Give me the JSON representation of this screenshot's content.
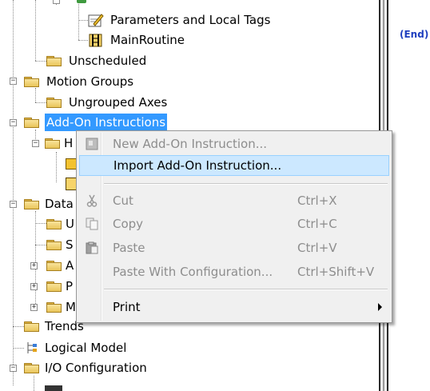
{
  "tree": {
    "parameters_label": "Parameters and Local Tags",
    "mainroutine_label": "MainRoutine",
    "unscheduled_label": "Unscheduled",
    "motion_groups_label": "Motion Groups",
    "ungrouped_axes_label": "Ungrouped Axes",
    "addon_label": "Add-On Instructions",
    "addon_child_partial": "H",
    "data_partial": "Data",
    "data_child1_partial": "U",
    "data_child2_partial": "S",
    "data_child3_partial": "A",
    "data_child4_partial": "P",
    "data_child5_partial": "M",
    "trends_label": "Trends",
    "logical_model_label": "Logical Model",
    "io_config_label": "I/O Configuration",
    "expander_collapse": "−",
    "expander_expand": "+"
  },
  "rung": {
    "end_label": "(End)"
  },
  "context_menu": {
    "new_aoi": "New Add-On Instruction...",
    "import_aoi": "Import Add-On Instruction...",
    "cut": "Cut",
    "cut_key": "Ctrl+X",
    "copy": "Copy",
    "copy_key": "Ctrl+C",
    "paste": "Paste",
    "paste_key": "Ctrl+V",
    "paste_config": "Paste With Configuration...",
    "paste_config_key": "Ctrl+Shift+V",
    "print": "Print"
  },
  "colors": {
    "selection": "#3399ff",
    "menu_highlight": "#cce8ff",
    "end_text": "#1f3fbf",
    "disabled_text": "#8d8d8d"
  }
}
